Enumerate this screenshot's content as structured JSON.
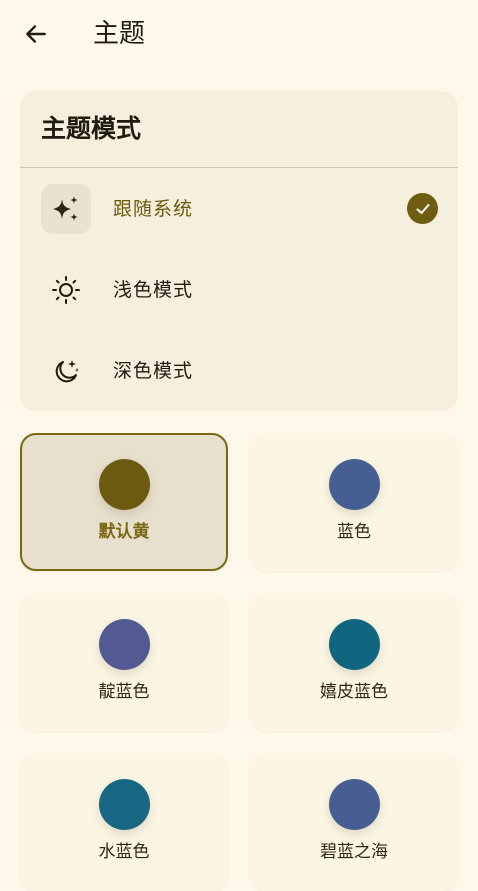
{
  "header": {
    "title": "主题"
  },
  "theme_mode": {
    "title": "主题模式",
    "options": [
      {
        "label": "跟随系统",
        "icon": "sparkle-icon",
        "selected": true
      },
      {
        "label": "浅色模式",
        "icon": "sun-icon",
        "selected": false
      },
      {
        "label": "深色模式",
        "icon": "moon-stars-icon",
        "selected": false
      }
    ]
  },
  "colors": {
    "items": [
      {
        "label": "默认黄",
        "color": "#6c5a11",
        "selected": true
      },
      {
        "label": "蓝色",
        "color": "#455f93",
        "selected": false
      },
      {
        "label": "靛蓝色",
        "color": "#535a92",
        "selected": false
      },
      {
        "label": "嬉皮蓝色",
        "color": "#11667f",
        "selected": false
      },
      {
        "label": "水蓝色",
        "color": "#176783",
        "selected": false
      },
      {
        "label": "碧蓝之海",
        "color": "#465e92",
        "selected": false
      }
    ]
  },
  "accent": {
    "primary": "#6e5d11",
    "background": "#fdf8ea",
    "card": "#f5f0de"
  }
}
